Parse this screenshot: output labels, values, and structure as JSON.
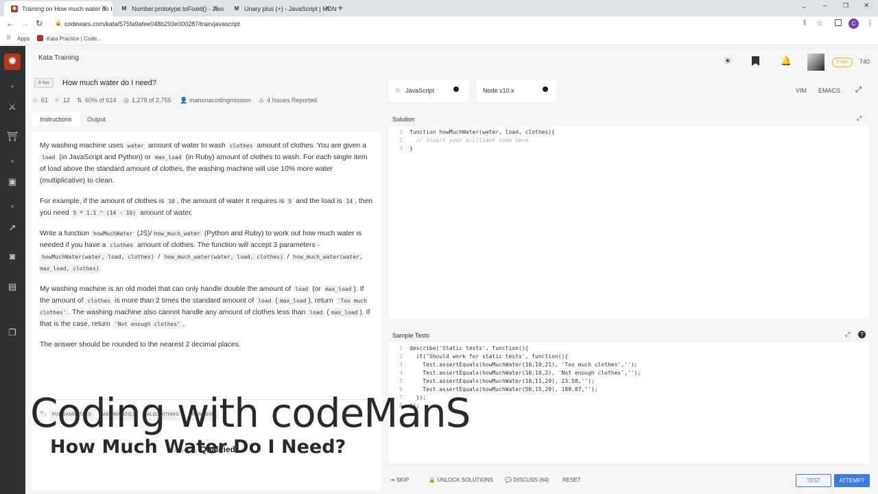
{
  "browser": {
    "tabs": [
      {
        "title": "Training on How much water do I ...",
        "favicon": "codewars"
      },
      {
        "title": "Number.prototype.toFixed() - Java...",
        "favicon": "mdn"
      },
      {
        "title": "Unary plus (+) - JavaScript | MDN",
        "favicon": "mdn"
      }
    ],
    "url": "codewars.com/kata/575fa9afee048b293e000287/train/javascript",
    "bookmarks": [
      "Apps",
      "Kata Practice | Code..."
    ],
    "profile_initial": "C"
  },
  "header": {
    "section": "Kata Training",
    "rank_badge": "5 kyu",
    "honor": "740"
  },
  "kata": {
    "kyu": "8 kyu",
    "title": "How much water do I need?",
    "stars": "61",
    "forks": "12",
    "satisfaction": "60% of 614",
    "completed": "1,278 of 2,755",
    "author": "manonacodingmission",
    "issues": "4 Issues Reported"
  },
  "tabs": {
    "instructions": "Instructions",
    "output": "Output"
  },
  "description": {
    "p1": [
      "My washing machine uses ",
      "water",
      " amount of water to wash ",
      "clothes",
      " amount of clothes. You are given a ",
      "load",
      " (in JavaScript and Python) or ",
      "max_load",
      " (in Ruby) amount of clothes to wash. For each single item of load above the standard amount of clothes, the washing machine will use 10% more water (multiplicative) to clean."
    ],
    "p2": [
      "For example, if the amount of clothes is ",
      "10",
      ", the amount of water it requires is ",
      "5",
      " and the load is ",
      "14",
      ", then you need ",
      "5 * 1.1 ^ (14 - 10)",
      " amount of water."
    ],
    "p3": [
      "Write a function ",
      "howMuchWater",
      " (JS)/",
      "how_much_water",
      " (Python and Ruby) to work out how much water is needed if you have a ",
      "clothes",
      " amount of clothes. The function will accept 3 parameters - ",
      "howMuchWater(water, load, clothes)",
      " / ",
      "how_much_water(water, load, clothes)",
      " / ",
      "how_much_water(water, max_load, clothes)"
    ],
    "p4": [
      "My washing machine is an old model that can only handle double the amount of ",
      "load",
      " (or ",
      "max_load",
      "). If the amount of ",
      "clothes",
      " is more than 2 times the standard amount of ",
      "load",
      " (",
      "max_load",
      "), return ",
      "'Too much clothes'",
      ". The washing machine also cannot handle any amount of clothes less than ",
      "load",
      " (",
      "max_load",
      "). If that is the case, return ",
      "'Not enough clothes'",
      "."
    ],
    "p5": "The answer should be rounded to the nearest 2 decimal places."
  },
  "tags": [
    "FUNDAMENTALS",
    "MATHEMATICS",
    "ALGORITHMS",
    "NUMBERS"
  ],
  "powered_by": {
    "label": "powered by",
    "brand": "Qualified"
  },
  "overlay": {
    "title": "Coding with codeManS",
    "subtitle": "How Much Water Do I Need?"
  },
  "editor": {
    "language": "JavaScript",
    "runtime": "Node v10.x",
    "modes": [
      "VIM",
      "EMACS"
    ],
    "solution_label": "Solution",
    "solution_lines": [
      "function howMuchWater(water, load, clothes){",
      "  // Insert your brilliant code here",
      "}"
    ],
    "tests_label": "Sample Tests",
    "test_lines": [
      "describe('Static tests', function(){",
      "  it('Should work for static tests', function(){",
      "    Test.assertEquals(howMuchWater(10,10,21), 'Too much clothes','');",
      "    Test.assertEquals(howMuchWater(10,10,2), 'Not enough clothes','');",
      "    Test.assertEquals(howMuchWater(10,11,20), 23.58,'');",
      "    Test.assertEquals(howMuchWater(50,15,29), 189.87,'');",
      "  });",
      "});"
    ]
  },
  "actions": {
    "skip": "SKIP",
    "unlock": "UNLOCK SOLUTIONS",
    "discuss": "DISCUSS (64)",
    "reset": "RESET",
    "test": "TEST",
    "attempt": "ATTEMPT"
  },
  "colors": {
    "brand": "#b1361e",
    "accent": "#3d7ae0",
    "sidebar": "#303133"
  }
}
